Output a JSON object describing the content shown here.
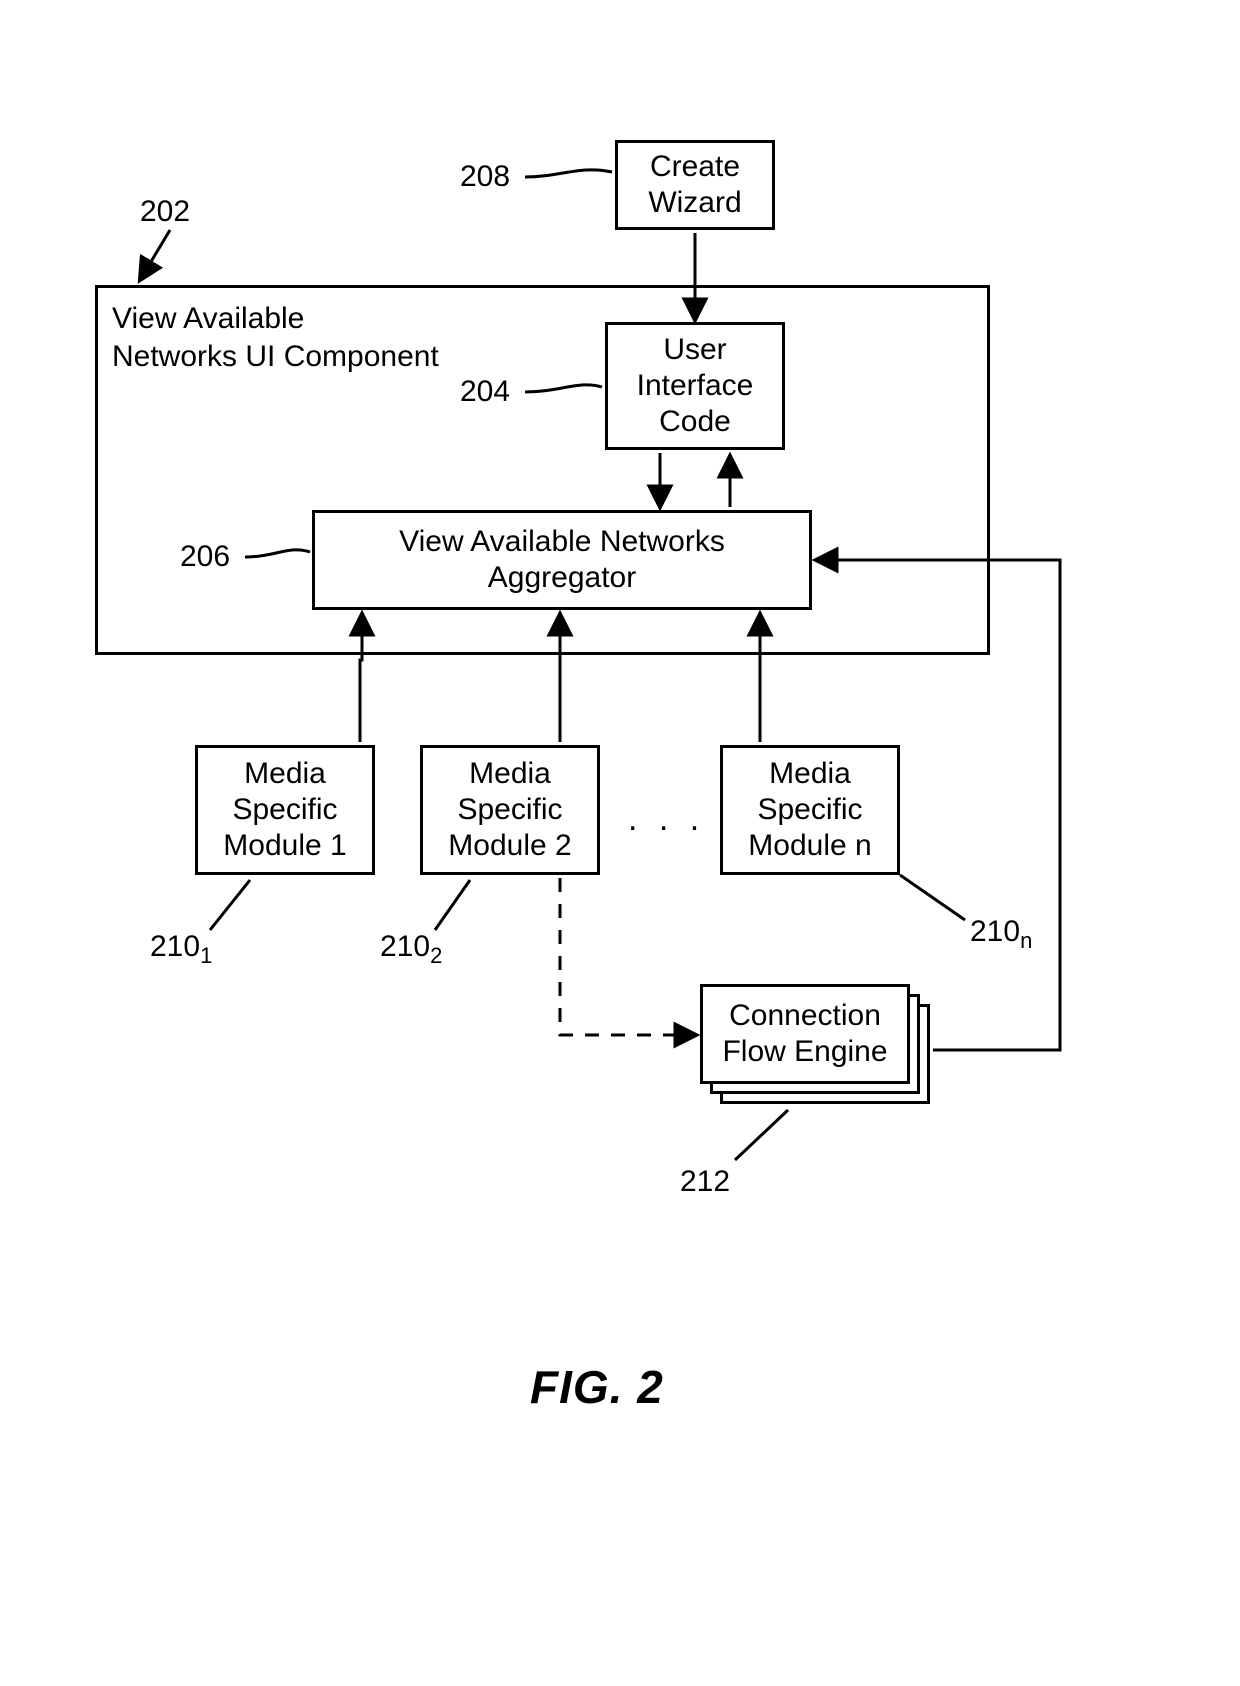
{
  "figure_title": "FIG. 2",
  "labels": {
    "n202": "202",
    "n204": "204",
    "n206": "206",
    "n208": "208",
    "n210_1": "210",
    "n210_2": "210",
    "n210_n": "210",
    "n212": "212",
    "s1": "1",
    "s2": "2",
    "sn": "n"
  },
  "container": {
    "title_line1": "View Available",
    "title_line2": "Networks UI Component"
  },
  "boxes": {
    "create_wizard_l1": "Create",
    "create_wizard_l2": "Wizard",
    "ui_code_l1": "User",
    "ui_code_l2": "Interface",
    "ui_code_l3": "Code",
    "aggregator_l1": "View Available Networks",
    "aggregator_l2": "Aggregator",
    "msm1_l1": "Media",
    "msm1_l2": "Specific",
    "msm1_l3": "Module 1",
    "msm2_l1": "Media",
    "msm2_l2": "Specific",
    "msm2_l3": "Module 2",
    "msmn_l1": "Media",
    "msmn_l2": "Specific",
    "msmn_l3": "Module n",
    "cfe_l1": "Connection",
    "cfe_l2": "Flow Engine",
    "ellipsis": ". . ."
  }
}
